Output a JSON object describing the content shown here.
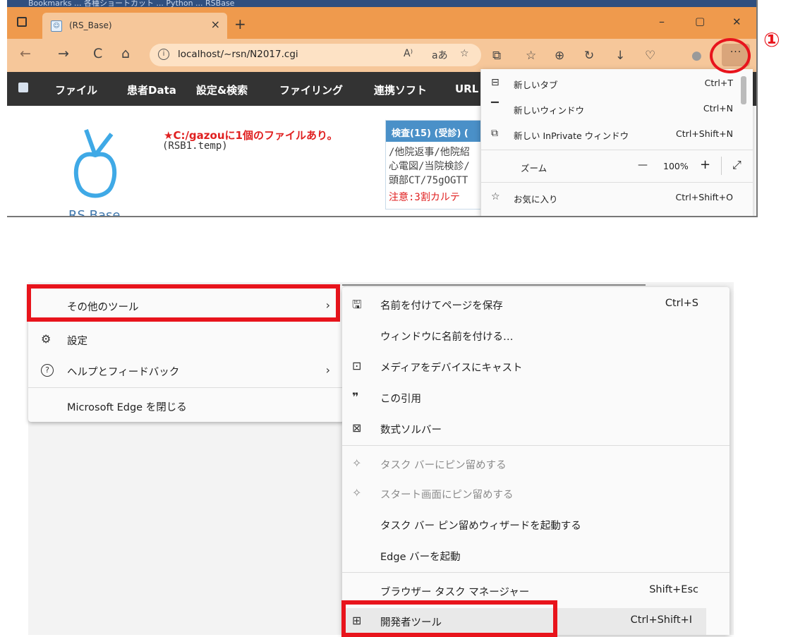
{
  "browser": {
    "top_strip_text": "Bookmarks ... 各種ショートカット ... Python ... RSBase",
    "tab": {
      "title": "(RS_Base)",
      "favicon": "rsbase-favicon",
      "close": "×"
    },
    "new_tab": "+",
    "window_controls": {
      "minimize": "–",
      "maximize": "▢",
      "close": "✕"
    },
    "nav": {
      "back": "←",
      "forward": "→",
      "refresh": "C",
      "home": "⌂"
    },
    "url": "localhost/~rsn/N2017.cgi",
    "url_info": "i",
    "url_icons": {
      "read_aloud": "A⁾",
      "translate": "aあ",
      "favorite_add": "☆"
    },
    "toolbar_icons": {
      "extensions": "⧉",
      "favorites": "☆",
      "collections": "⊕",
      "history": "↻",
      "downloads": "↓",
      "performance": "♡",
      "profile": "●"
    },
    "more_button": "···"
  },
  "site": {
    "menu": [
      "ファイル",
      "患者Data",
      "設定&検索",
      "ファイリング",
      "連携ソフト",
      "URL"
    ],
    "logo_text": "RS.Base",
    "warning_line1": "★C:/gazouに1個のファイルあり。",
    "warning_line2": "(RSB1.temp)",
    "panel": {
      "header": "検査(15) (受診) (",
      "lines": [
        "/他院返事/他院紹",
        "心電図/当院検診/",
        "頭部CT/75gOGTT"
      ],
      "alert": "注意:3割カルテ"
    }
  },
  "edge_menu": {
    "items": [
      {
        "icon": "new-tab-icon",
        "glyph": "⊟",
        "label": "新しいタブ",
        "shortcut": "Ctrl+T"
      },
      {
        "icon": "new-window-icon",
        "glyph": "▔",
        "label": "新しいウィンドウ",
        "shortcut": "Ctrl+N"
      },
      {
        "icon": "inprivate-icon",
        "glyph": "⧉",
        "label": "新しい InPrivate ウィンドウ",
        "shortcut": "Ctrl+Shift+N"
      },
      {
        "label": "ズーム",
        "zoom_minus": "—",
        "zoom_value": "100%",
        "zoom_plus": "+",
        "fullscreen": "⤢"
      },
      {
        "icon": "favorites-icon",
        "glyph": "☆",
        "label": "お気に入り",
        "shortcut": "Ctrl+Shift+O"
      }
    ]
  },
  "annotation": {
    "number": "①"
  },
  "menu_left": {
    "items": [
      {
        "label": "その他のツール",
        "chevron": "›"
      },
      {
        "icon": "gear-icon",
        "glyph": "⚙",
        "label": "設定"
      },
      {
        "icon": "help-icon",
        "glyph": "?",
        "label": "ヘルプとフィードバック",
        "chevron": "›"
      },
      {
        "label": "Microsoft Edge を閉じる"
      }
    ]
  },
  "menu_right": {
    "items": [
      {
        "icon": "save-page-icon",
        "glyph": "🖫",
        "label": "名前を付けてページを保存",
        "shortcut": "Ctrl+S"
      },
      {
        "label": "ウィンドウに名前を付ける…"
      },
      {
        "icon": "cast-icon",
        "glyph": "⊡",
        "label": "メディアをデバイスにキャスト"
      },
      {
        "icon": "quote-icon",
        "glyph": "❞",
        "label": "この引用"
      },
      {
        "icon": "math-solver-icon",
        "glyph": "⊠",
        "label": "数式ソルバー"
      },
      {
        "icon": "pin-icon",
        "glyph": "✧",
        "label": "タスク バーにピン留めする",
        "disabled": true
      },
      {
        "icon": "pin-icon",
        "glyph": "✧",
        "label": "スタート画面にピン留めする",
        "disabled": true
      },
      {
        "label": "タスク バー ピン留めウィザードを起動する"
      },
      {
        "label": "Edge バーを起動"
      },
      {
        "label": "ブラウザー タスク マネージャー",
        "shortcut": "Shift+Esc"
      },
      {
        "icon": "devtools-icon",
        "glyph": "⊞",
        "label": "開発者ツール",
        "shortcut": "Ctrl+Shift+I"
      }
    ]
  },
  "colors": {
    "tabbar": "#ef9a4d",
    "addressbar": "#f6c79a",
    "highlight": "#e8141c"
  }
}
